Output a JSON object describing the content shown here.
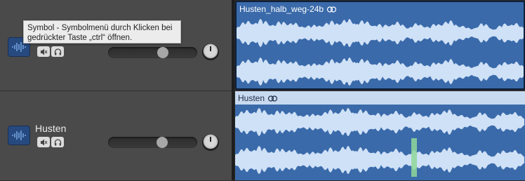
{
  "tooltip": {
    "line1": "Symbol - Symbolmenü durch Klicken bei",
    "line2": "gedrückter Taste „ctrl“ öffnen."
  },
  "tracks": [
    {
      "name": "",
      "volume": 0.63,
      "icons": [
        "waveform-icon",
        "mute-icon",
        "headphones-icon"
      ]
    },
    {
      "name": "Husten",
      "volume": 0.62,
      "icons": [
        "waveform-icon",
        "mute-icon",
        "headphones-icon"
      ]
    }
  ],
  "regions": [
    {
      "name": "Husten_halb_weg-24b",
      "icon": "loop-rings-icon",
      "selected": true
    },
    {
      "name": "Husten",
      "icon": "loop-rings-icon",
      "selected": false
    }
  ],
  "colors": {
    "track_header_bg": "#4a4a4a",
    "region_bg": "#3a6aaa",
    "waveform": "#cfe1f7",
    "playhead_highlight": "#8fd79a"
  }
}
